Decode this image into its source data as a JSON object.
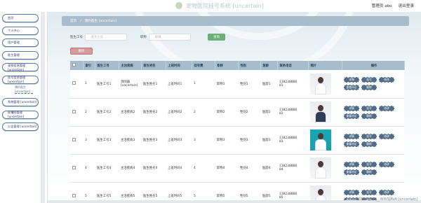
{
  "app": {
    "title": "宠物医院挂号系统 [uncertain]"
  },
  "top_right": {
    "user": "管理员 abo",
    "logout": "退出登录"
  },
  "sidebar": {
    "items": [
      {
        "label": "首页"
      },
      {
        "label": "个人中心"
      },
      {
        "label": "用户管理"
      },
      {
        "label": "医生管理"
      },
      {
        "label": "宠物信息管理 [uncertain]"
      },
      {
        "label": "挂号信息管理 [uncertain]"
      },
      {
        "label": "系统管理 [uncertain]"
      },
      {
        "label": "轮播图管理 [uncertain]"
      },
      {
        "label": "公告管理 [uncertain]"
      }
    ],
    "sub": {
      "label": "预约医生 [uncertain]"
    }
  },
  "breadcrumb": {
    "home": "首页",
    "sep": "/",
    "current": "预约医生 [uncertain]"
  },
  "search": {
    "field1_label": "医生工号",
    "field1_placeholder": "医生工号",
    "field2_label": "职称",
    "field2_placeholder": "职称",
    "button": "查询"
  },
  "delete_button": "删除",
  "table": {
    "headers": [
      "",
      "索引",
      "医生工号",
      "主治疾病",
      "医生姓名",
      "上班时间",
      "挂号费",
      "职称",
      "性别",
      "医龄",
      "联系电话",
      "照片",
      "操作"
    ],
    "rows": [
      {
        "index": "1",
        "no": "医生工号1",
        "disease": "消除器 [uncertain]",
        "name": "医生姓名1",
        "time": "上班时间1",
        "fee": "1",
        "title": "职称1",
        "gender": "性别1",
        "age": "医龄1",
        "phone_a": "138238888",
        "phone_b": "81"
      },
      {
        "index": "2",
        "no": "医生工号2",
        "disease": "主治疾病2",
        "name": "医生姓名2",
        "time": "上班时间2",
        "fee": "2",
        "title": "职称2",
        "gender": "性别2",
        "age": "医龄2",
        "phone_a": "138238888",
        "phone_b": "82"
      },
      {
        "index": "3",
        "no": "医生工号3",
        "disease": "主治疾病3",
        "name": "医生姓名3",
        "time": "上班时间3",
        "fee": "3",
        "title": "职称3",
        "gender": "性别3",
        "age": "医龄3",
        "phone_a": "138238888",
        "phone_b": "83"
      },
      {
        "index": "4",
        "no": "医生工号4",
        "disease": "主治疾病4",
        "name": "医生姓名4",
        "time": "上班时间4",
        "fee": "4",
        "title": "职称4",
        "gender": "性别4",
        "age": "医龄4",
        "phone_a": "138238888",
        "phone_b": "84"
      },
      {
        "index": "5",
        "no": "医生工号5",
        "disease": "主治疾病5",
        "name": "医生姓名5",
        "time": "上班时间5",
        "fee": "5",
        "title": "职称5",
        "gender": "性别5",
        "age": "医龄5",
        "phone_a": "138238888",
        "phone_b": "85"
      }
    ],
    "ops": {
      "detail": "详情",
      "schedule": "挂号",
      "edit": "修改",
      "comment": "查看评论",
      "delete": "删除"
    }
  },
  "watermark": "CSDN @QQ__WWSJAVA [uncertain]",
  "colors": {
    "header": "#a6bdcd",
    "op_button": "#526d86",
    "search_button": "#6fae77",
    "delete_button": "#d39b9b"
  }
}
